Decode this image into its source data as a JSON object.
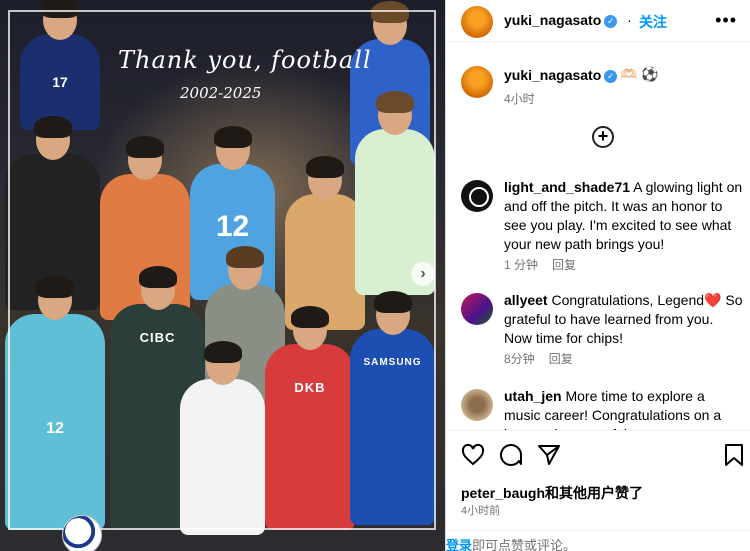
{
  "post_image": {
    "title": "Thank you, football",
    "years": "2002-2025"
  },
  "header": {
    "username": "yuki_nagasato",
    "separator": "·",
    "follow_label": "关注",
    "more_icon": "more-horizontal-icon"
  },
  "caption": {
    "username": "yuki_nagasato",
    "emoji": "🫶🏻 ⚽",
    "time": "4小时"
  },
  "comments": [
    {
      "username": "light_and_shade71",
      "text": "A glowing light on and off the pitch. It was an honor to see you play. I'm excited to see what your new path brings you!",
      "time": "1 分钟",
      "reply": "回复"
    },
    {
      "username": "allyeet",
      "text": "Congratulations, Legend",
      "emoji": "❤️",
      "text_after": "So grateful to have learned from you. Now time for chips!",
      "time": "8分钟",
      "reply": "回复"
    },
    {
      "username": "utah_jen",
      "text": "More time to explore a music career! Congratulations on a long and successful soccer career"
    }
  ],
  "likes": "peter_baugh和其他用户赞了",
  "post_time": "4小时前",
  "login": {
    "link": "登录",
    "rest": "即可点赞或评论。"
  },
  "colors": {
    "accent": "#0095f6",
    "verified": "#3897f0",
    "muted": "#737373"
  }
}
